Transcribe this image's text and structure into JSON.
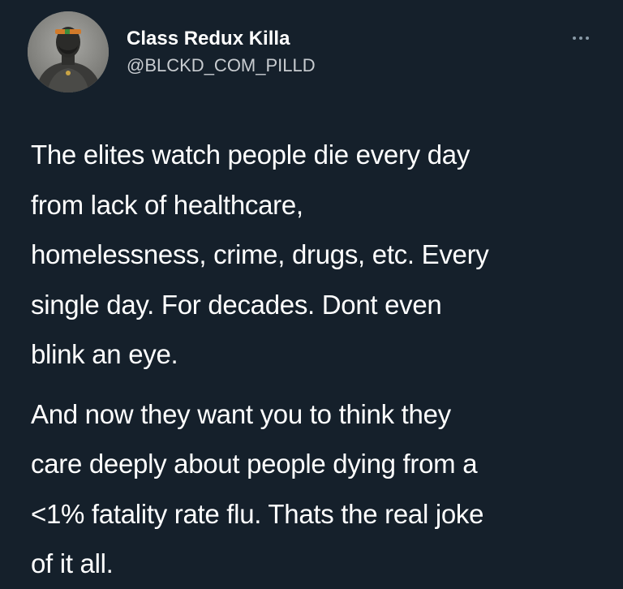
{
  "tweet": {
    "author": {
      "display_name": "Class Redux Killa",
      "handle": "@BLCKD_COM_PILLD",
      "avatar_icon": "profile-photo"
    },
    "more_icon": "more-options-icon",
    "paragraphs": [
      "The elites watch people die every day\nfrom lack of healthcare,\nhomelessness, crime, drugs, etc. Every\nsingle day. For decades. Dont even\nblink an eye.",
      "And now they want you to think they\ncare deeply about people dying from a\n<1% fatality rate flu. Thats the real joke\nof it all."
    ]
  },
  "colors": {
    "background": "#15202b",
    "text": "#ffffff",
    "secondary_text": "#c8ccd0",
    "icon": "#8899a6"
  }
}
